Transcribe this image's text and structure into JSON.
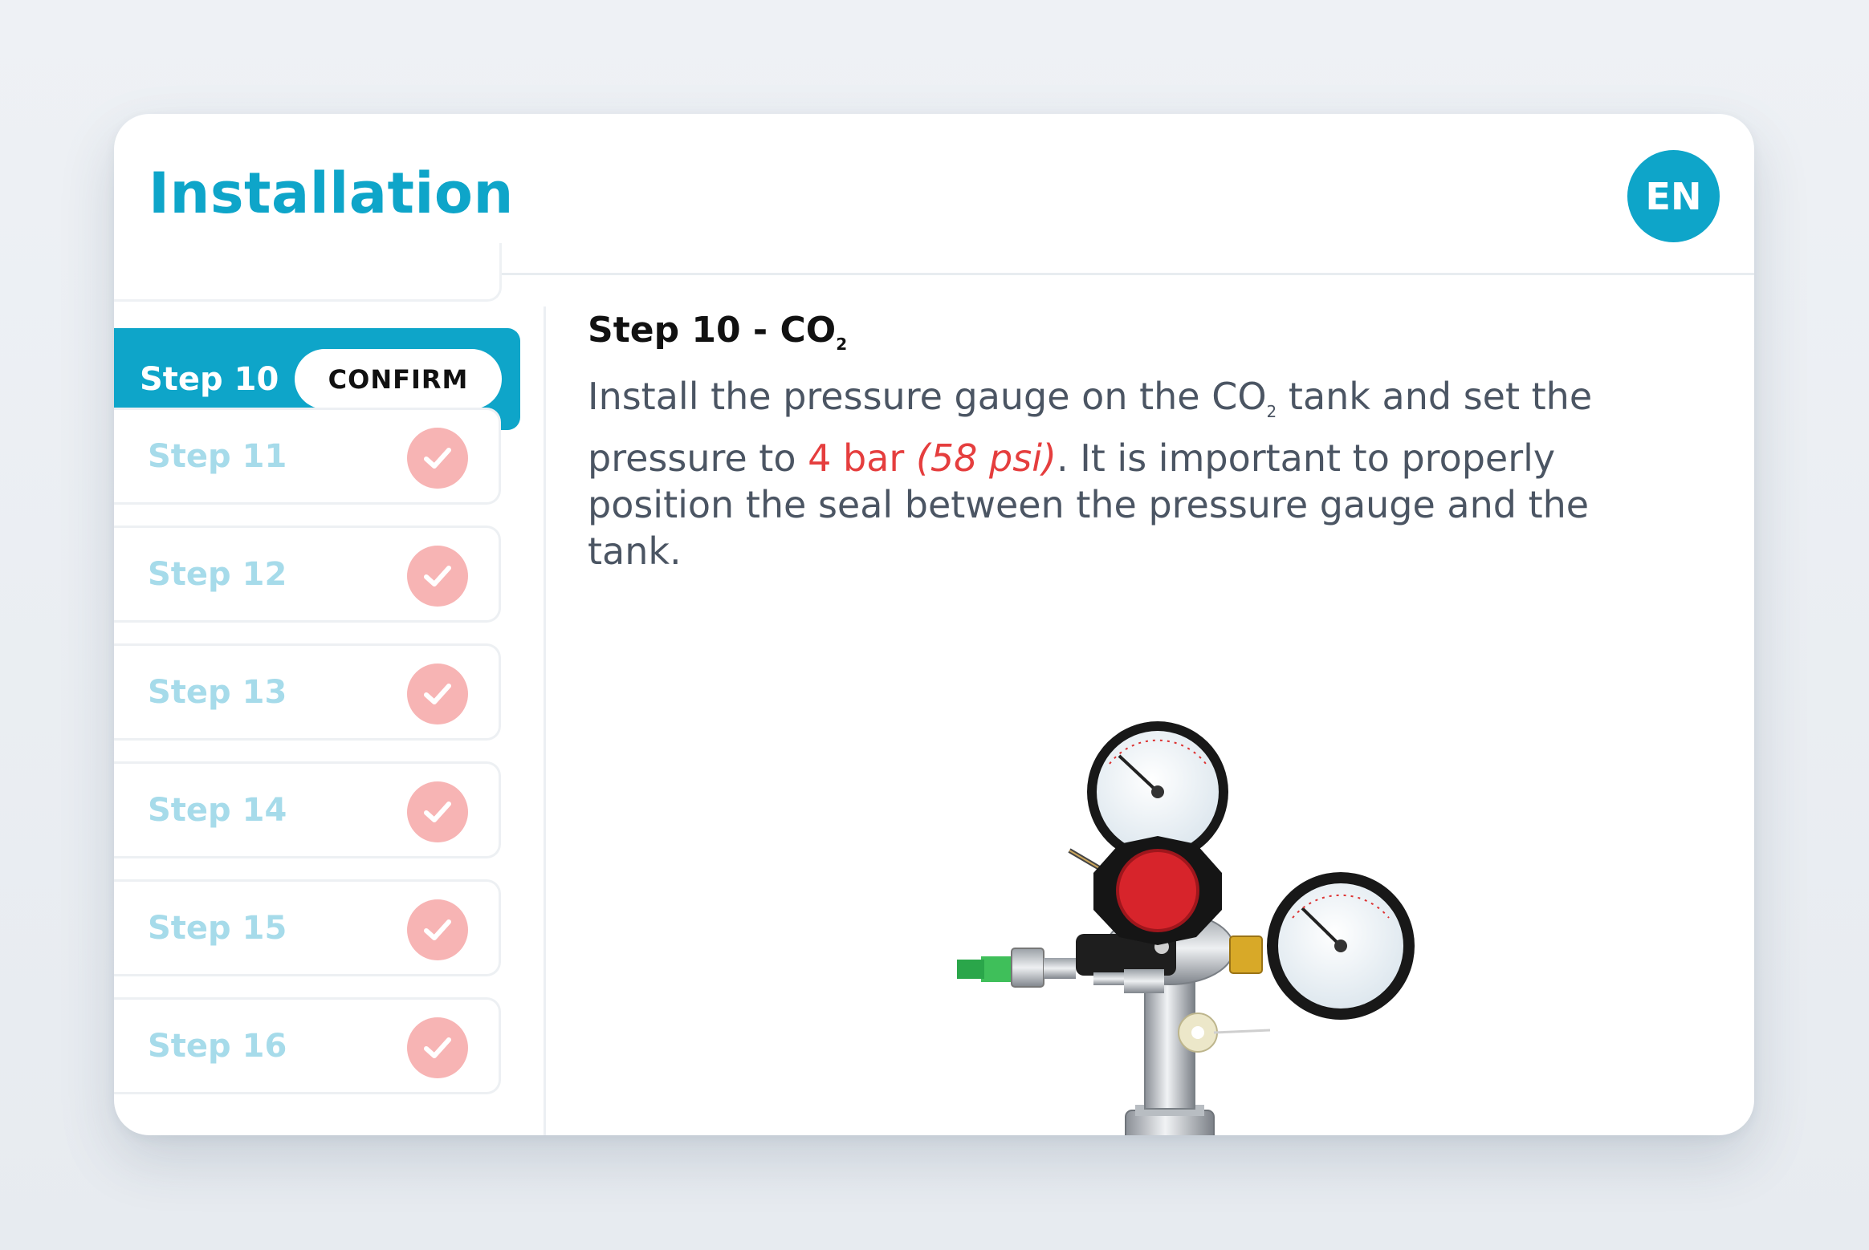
{
  "header": {
    "title": "Installation",
    "language": "EN"
  },
  "sidebar": {
    "active_step": {
      "label": "Step 10",
      "confirm_label": "CONFIRM"
    },
    "steps": [
      {
        "label": "Step 11",
        "status": "completed"
      },
      {
        "label": "Step 12",
        "status": "completed"
      },
      {
        "label": "Step 13",
        "status": "completed"
      },
      {
        "label": "Step 14",
        "status": "completed"
      },
      {
        "label": "Step 15",
        "status": "completed"
      },
      {
        "label": "Step 16",
        "status": "completed"
      }
    ]
  },
  "main": {
    "title_prefix": "Step 10 - CO",
    "title_subscript": "2",
    "desc_part1": "Install the pressure gauge on the CO",
    "desc_sub": "2",
    "desc_part2": " tank and set the pressure to ",
    "desc_pressure": "4 bar",
    "desc_psi": "(58 psi)",
    "desc_part3": ". It is important to properly position the seal between the pressure gauge and the tank."
  },
  "colors": {
    "accent": "#0ea5c9",
    "check_bg": "#f7b4b4",
    "warning_text": "#e53e3e"
  },
  "icons": {
    "completed": "check-icon",
    "product_image": "pressure-regulator-image"
  }
}
